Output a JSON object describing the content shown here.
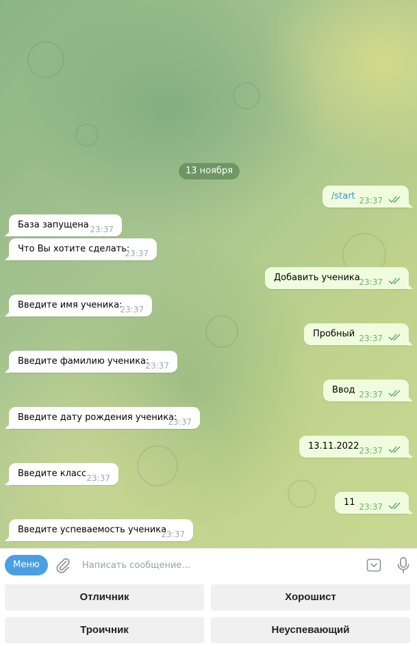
{
  "date_separator": "13 ноября",
  "messages": [
    {
      "id": 0,
      "direction": "out",
      "text": "/start",
      "time": "23:37",
      "is_command": true
    },
    {
      "id": 1,
      "direction": "in",
      "text": "База запущена",
      "time": "23:37"
    },
    {
      "id": 2,
      "direction": "in",
      "text": "Что Вы хотите сделать:",
      "time": "23:37"
    },
    {
      "id": 3,
      "direction": "out",
      "text": "Добавить ученика",
      "time": "23:37"
    },
    {
      "id": 4,
      "direction": "in",
      "text": "Введите имя ученика:",
      "time": "23:37"
    },
    {
      "id": 5,
      "direction": "out",
      "text": "Пробный",
      "time": "23:37"
    },
    {
      "id": 6,
      "direction": "in",
      "text": "Введите фамилию ученика:",
      "time": "23:37"
    },
    {
      "id": 7,
      "direction": "out",
      "text": "Ввод",
      "time": "23:37"
    },
    {
      "id": 8,
      "direction": "in",
      "text": "Введите дату рождения ученика:",
      "time": "23:37"
    },
    {
      "id": 9,
      "direction": "out",
      "text": "13.11.2022",
      "time": "23:37"
    },
    {
      "id": 10,
      "direction": "in",
      "text": "Введите класс",
      "time": "23:37"
    },
    {
      "id": 11,
      "direction": "out",
      "text": "11",
      "time": "23:37"
    },
    {
      "id": 12,
      "direction": "in",
      "text": "Введите успеваемость ученика",
      "time": "23:37"
    }
  ],
  "composer": {
    "menu_label": "Меню",
    "placeholder": "Написать сообщение...",
    "icons": [
      "paperclip-icon",
      "keyboard-toggle-icon",
      "microphone-icon"
    ]
  },
  "reply_keyboard": [
    {
      "label": "Отличник"
    },
    {
      "label": "Хорошист"
    },
    {
      "label": "Троичник"
    },
    {
      "label": "Неуспевающий"
    }
  ],
  "colors": {
    "accent": "#4a9fe3",
    "outgoing_bubble": "#effdde",
    "incoming_bubble": "#ffffff",
    "read_check": "#6fb26a"
  }
}
